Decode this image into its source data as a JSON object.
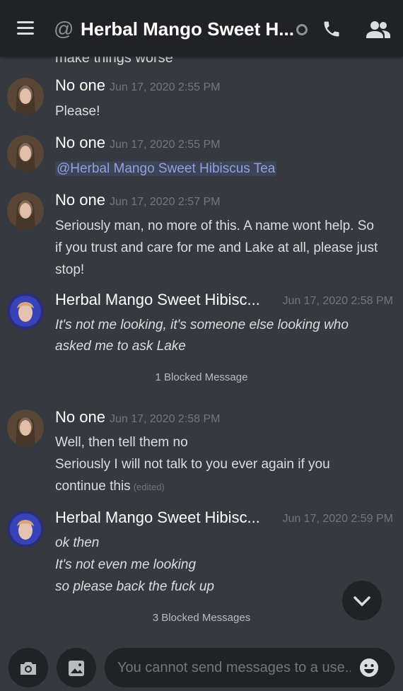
{
  "header": {
    "title": "Herbal Mango Sweet H...",
    "at_symbol": "@",
    "icons": [
      "menu-icon",
      "at-icon",
      "status-offline-icon",
      "phone-call-icon",
      "members-icon"
    ]
  },
  "cutoff_text": "make things worse",
  "messages": [
    {
      "author": "No one",
      "timestamp": "Jun 17, 2020 2:55 PM",
      "lines": [
        "Please!"
      ]
    },
    {
      "author": "No one",
      "timestamp": "Jun 17, 2020 2:55 PM",
      "mention": "@Herbal Mango Sweet Hibiscus Tea"
    },
    {
      "author": "No one",
      "timestamp": "Jun 17, 2020 2:57 PM",
      "lines": [
        "Seriously man, no more of this. A name wont help. So",
        "if you trust and care for me and Lake at all, please just",
        "stop!"
      ]
    },
    {
      "author": "Herbal Mango Sweet Hibisc...",
      "timestamp": "Jun 17, 2020 2:58 PM",
      "lines": [
        "It's not me looking, it's someone else looking who",
        "asked me to ask Lake"
      ]
    },
    {
      "author": "No one",
      "timestamp": "Jun 17, 2020 2:58 PM",
      "lines": [
        "Well, then tell them no",
        "Seriously I will not talk to you ever again if you",
        "continue this"
      ],
      "edited": "(edited)"
    },
    {
      "author": "Herbal Mango Sweet Hibisc...",
      "timestamp": "Jun 17, 2020 2:59 PM",
      "lines": [
        "ok then",
        "It's not even me looking",
        "so please back the fuck up"
      ]
    }
  ],
  "blocked": {
    "one": "1 Blocked Message",
    "three": "3 Blocked Messages"
  },
  "composer": {
    "placeholder": "You cannot send messages to a use...",
    "icons": [
      "camera-icon",
      "image-icon",
      "emoji-icon"
    ]
  },
  "colors": {
    "background": "#36393f",
    "header": "#202225",
    "mention": "#8ea1e1",
    "timestamp": "#72767d"
  }
}
